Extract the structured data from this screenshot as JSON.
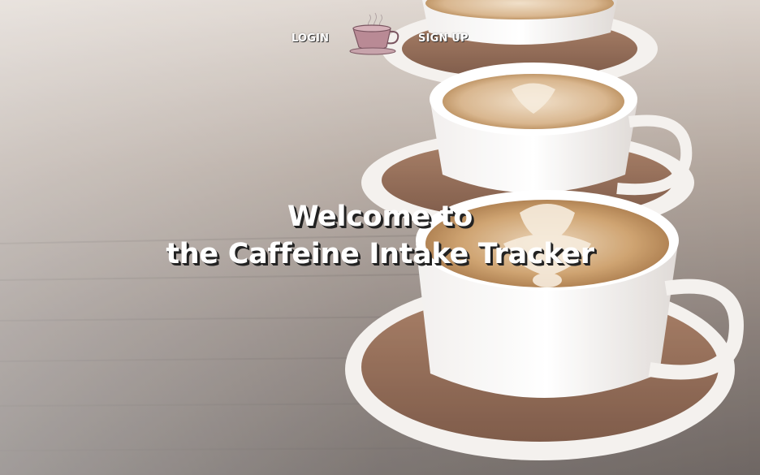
{
  "nav": {
    "login_label": "LOGIN",
    "signup_label": "SIGN UP"
  },
  "hero": {
    "line1": "Welcome to",
    "line2": "the Caffeine Intake Tracker"
  },
  "colors": {
    "nav_text": "#ffffff",
    "hero_text": "#ffffff",
    "text_shadow": "#222222",
    "logo_cup": "#b07a86"
  },
  "icons": {
    "logo": "coffee-cup-icon"
  }
}
